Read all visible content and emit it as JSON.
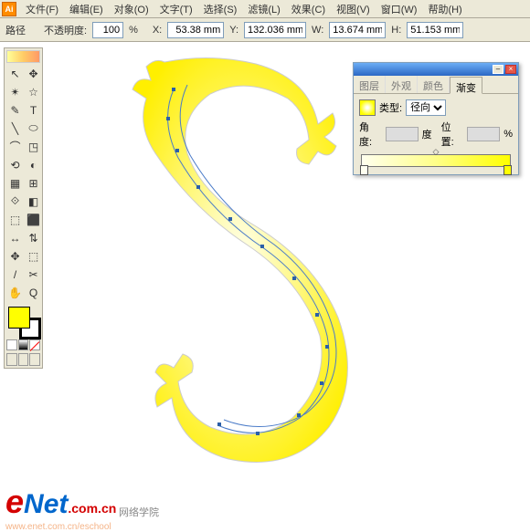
{
  "menu": {
    "items": [
      "文件(F)",
      "编辑(E)",
      "对象(O)",
      "文字(T)",
      "选择(S)",
      "滤镜(L)",
      "效果(C)",
      "视图(V)",
      "窗口(W)",
      "帮助(H)"
    ]
  },
  "optbar": {
    "mode": "路径",
    "opacity_lbl": "不透明度:",
    "opacity": "100",
    "opacity_unit": "%",
    "x_lbl": "X:",
    "x": "53.38 mm",
    "y_lbl": "Y:",
    "y": "132.036 mm",
    "w_lbl": "W:",
    "w": "13.674 mm",
    "h_lbl": "H:",
    "h": "51.153 mm"
  },
  "tools": [
    "⬚",
    "↖",
    "✥",
    "⬜",
    "✴",
    "☆",
    "✎",
    "T",
    "╲",
    "⬭",
    "⌒",
    "◳",
    "⎋",
    "✂",
    "⟲",
    "◐",
    "▦",
    "⊞",
    "⟐",
    "◧",
    "⬚",
    "⬛",
    "↔",
    "⇅",
    "✥",
    "⬚",
    "/",
    "◫",
    "✎",
    "Q",
    "◲",
    "✋"
  ],
  "panel": {
    "tabs": [
      "图层",
      "外观",
      "颜色",
      "渐变"
    ],
    "active_tab": "渐变",
    "type_lbl": "类型:",
    "type_val": "径向",
    "angle_lbl": "角度:",
    "angle_unit": "度",
    "pos_lbl": "位置:",
    "pos_unit": "%"
  },
  "watermark": {
    "e": "e",
    "net": "Net",
    "com": ".com.cn",
    "sub": "网络学院",
    "url": "www.enet.com.cn/eschool"
  }
}
